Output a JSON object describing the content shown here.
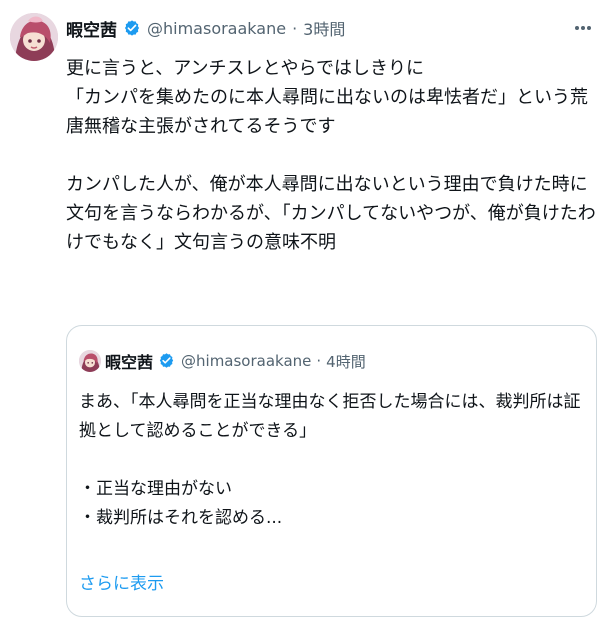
{
  "tweet": {
    "author_name": "暇空茜",
    "handle": "@himasoraakane",
    "separator": "·",
    "time": "3時間",
    "more_icon": "more-horizontal-icon",
    "text": "更に言うと、アンチスレとやらではしきりに\n「カンパを集めたのに本人尋問に出ないのは卑怯者だ」という荒唐無稽な主張がされてるそうです\n\nカンパした人が、俺が本人尋問に出ないという理由で負けた時に文句を言うならわかるが、「カンパしてないやつが、俺が負けたわけでもなく」文句言うの意味不明"
  },
  "quote": {
    "author_name": "暇空茜",
    "handle": "@himasoraakane",
    "separator": "·",
    "time": "4時間",
    "text": "まあ、「本人尋問を正当な理由なく拒否した場合には、裁判所は証拠として認めることができる」\n\n・正当な理由がない\n・裁判所はそれを認める...",
    "show_more": "さらに表示"
  },
  "colors": {
    "verified": "#1d9bf0",
    "link": "#1d9bf0",
    "muted": "#536471",
    "border": "#cfd9de"
  }
}
